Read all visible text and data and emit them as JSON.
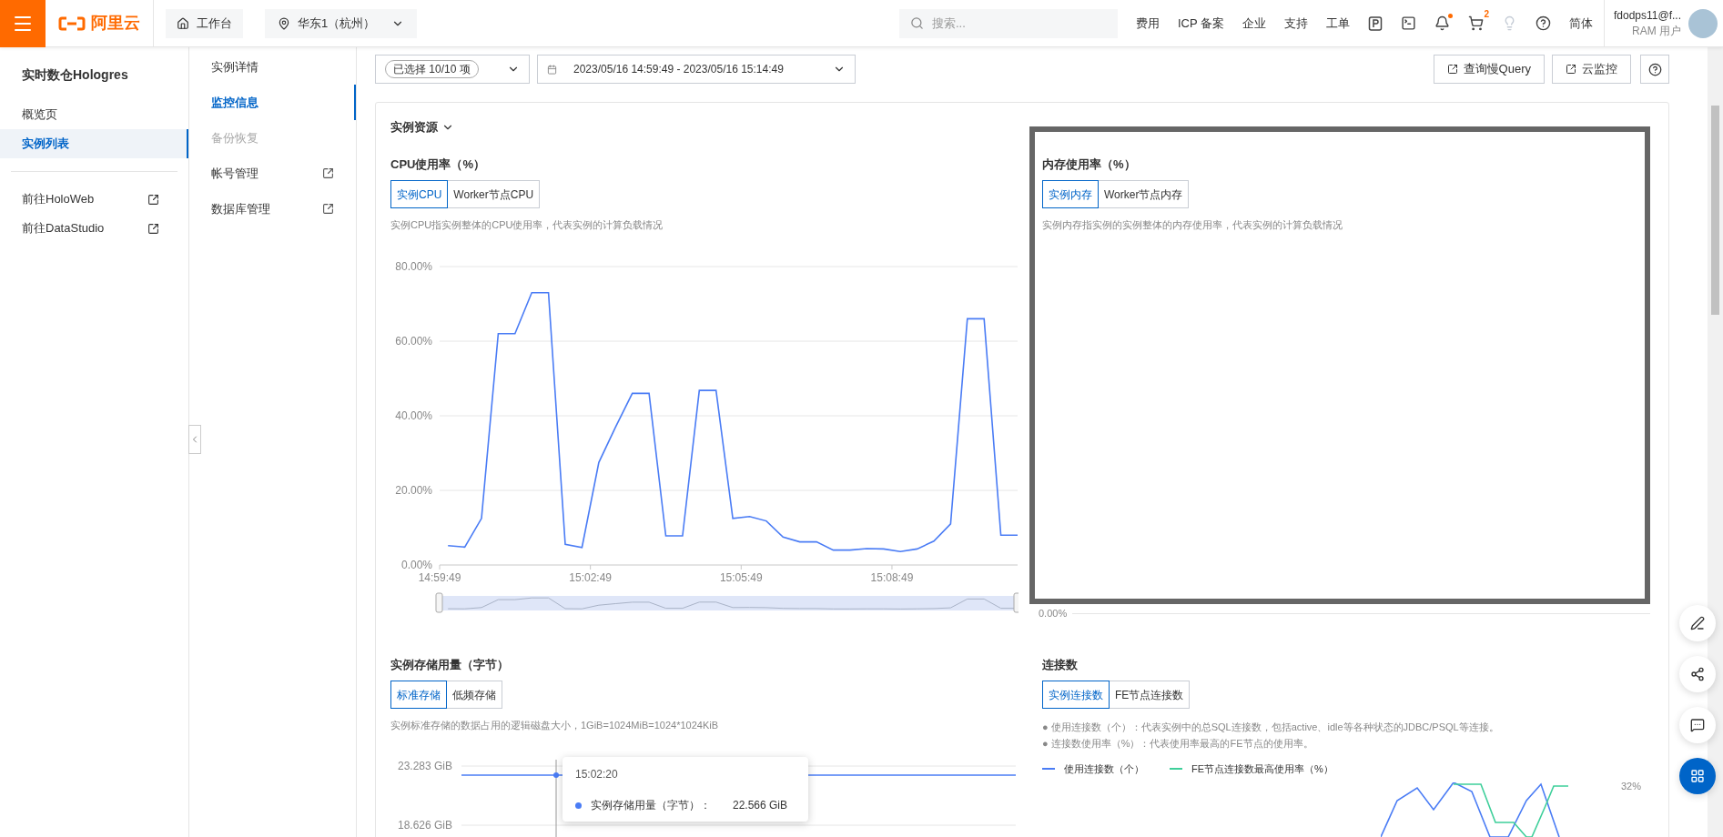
{
  "top_bar": {
    "logo": "阿里云",
    "workbench": "工作台",
    "region": "华东1（杭州）",
    "search": {
      "placeholder": "搜索..."
    },
    "links": [
      "费用",
      "ICP 备案",
      "企业",
      "支持",
      "工单"
    ],
    "cart_badge": "2",
    "language": "简体",
    "user": {
      "name": "fdodps11@f...",
      "role": "RAM 用户"
    }
  },
  "sidebar": {
    "title": "实时数仓Hologres",
    "items": [
      {
        "label": "概览页",
        "selected": false
      },
      {
        "label": "实例列表",
        "selected": true
      }
    ],
    "links": [
      "前往HoloWeb",
      "前往DataStudio"
    ]
  },
  "subnav": {
    "items": [
      {
        "label": "实例详情",
        "selected": false,
        "disabled": false,
        "external": false
      },
      {
        "label": "监控信息",
        "selected": true,
        "disabled": false,
        "external": false
      },
      {
        "label": "备份恢复",
        "selected": false,
        "disabled": true,
        "external": false
      },
      {
        "label": "帐号管理",
        "selected": false,
        "disabled": false,
        "external": true
      },
      {
        "label": "数据库管理",
        "selected": false,
        "disabled": false,
        "external": true
      }
    ]
  },
  "toolbar": {
    "selector": "已选择 10/10 项",
    "time_range": "2023/05/16 14:59:49 - 2023/05/16 15:14:49",
    "buttons": [
      "查询慢Query",
      "云监控"
    ]
  },
  "resources": {
    "title": "实例资源",
    "cpu": {
      "title": "CPU使用率（%）",
      "tabs": [
        {
          "label": "实例CPU",
          "selected": true
        },
        {
          "label": "Worker节点CPU",
          "selected": false
        }
      ],
      "description": "实例CPU指实例整体的CPU使用率，代表实例的计算负载情况",
      "chart_data": {
        "type": "line",
        "x": [
          53999,
          54019,
          54039,
          54059,
          54079,
          54099,
          54119,
          54139,
          54159,
          54179,
          54199,
          54219,
          54239,
          54259,
          54279,
          54299,
          54319,
          54339,
          54359,
          54379,
          54399,
          54419,
          54439,
          54459,
          54479,
          54499,
          54519,
          54539,
          54559,
          54579,
          54599,
          54619,
          54639,
          54659,
          54679
        ],
        "series": [
          {
            "color": "#4a7cf5",
            "values": [
              5.2,
              4.8,
              12.5,
              62,
              62,
              73,
              73,
              5.5,
              4.7,
              27.5,
              37,
              46,
              46,
              7.8,
              7.8,
              46.8,
              46.8,
              12.5,
              13,
              11.8,
              7.5,
              6.2,
              6.2,
              4,
              4,
              4.4,
              4.3,
              3.6,
              4.3,
              6.4,
              11,
              66,
              66,
              8,
              8
            ]
          }
        ],
        "xlim": [
          53989,
          54679
        ],
        "ylim": [
          0,
          80
        ],
        "grid": true,
        "xticks": [
          {
            "value": 53989,
            "label": "14:59:49"
          },
          {
            "value": 54169,
            "label": "15:02:49"
          },
          {
            "value": 54349,
            "label": "15:05:49"
          },
          {
            "value": 54529,
            "label": "15:08:49"
          }
        ],
        "yticks": [
          {
            "value": 0,
            "label": "0.00%"
          },
          {
            "value": 20,
            "label": "20.00%"
          },
          {
            "value": 40,
            "label": "40.00%"
          },
          {
            "value": 60,
            "label": "60.00%"
          },
          {
            "value": 80,
            "label": "80.00%"
          }
        ]
      }
    },
    "memory": {
      "title": "内存使用率（%）",
      "tabs": [
        {
          "label": "实例内存",
          "selected": true
        },
        {
          "label": "Worker节点内存",
          "selected": false
        }
      ],
      "description": "实例内存指实例的实例整体的内存使用率，代表实例的计算负载情况",
      "axis_label": "0.00%"
    },
    "storage": {
      "title": "实例存储用量（字节）",
      "tabs": [
        {
          "label": "标准存储",
          "selected": true
        },
        {
          "label": "低频存储",
          "selected": false
        }
      ],
      "description": "实例标准存储的数据占用的逻辑磁盘大小，1GiB=1024MiB=1024*1024KiB",
      "axis_labels": [
        "23.283 GiB",
        "18.626 GiB"
      ],
      "tooltip": {
        "time": "15:02:20",
        "label": "实例存储用量（字节）：",
        "value": "22.566 GiB"
      }
    },
    "connections": {
      "title": "连接数",
      "tabs": [
        {
          "label": "实例连接数",
          "selected": true
        },
        {
          "label": "FE节点连接数",
          "selected": false
        }
      ],
      "notes": [
        "● 使用连接数（个）：代表实例中的总SQL连接数，包括active、idle等各种状态的JDBC/PSQL等连接。",
        "● 连接数使用率（%）：代表使用率最高的FE节点的使用率。"
      ],
      "legend": [
        {
          "label": "使用连接数（个）",
          "color": "#4a7cf5"
        },
        {
          "label": "FE节点连接数最高使用率（%）",
          "color": "#3ecf9a"
        }
      ],
      "chart_label": "32%"
    }
  }
}
